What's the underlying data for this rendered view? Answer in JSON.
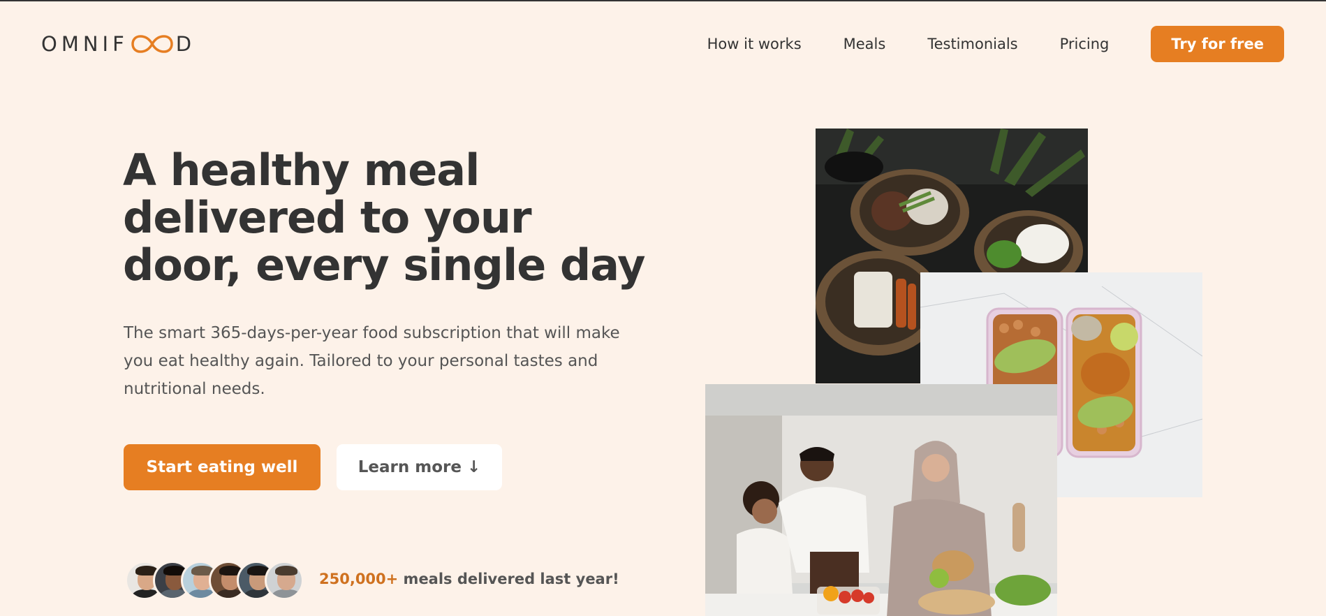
{
  "header": {
    "logo_text_left": "OMNIF",
    "logo_text_right": "D",
    "nav": [
      {
        "label": "How it works"
      },
      {
        "label": "Meals"
      },
      {
        "label": "Testimonials"
      },
      {
        "label": "Pricing"
      }
    ],
    "cta_label": "Try for free"
  },
  "hero": {
    "headline": "A healthy meal delivered to your door, every single day",
    "description": "The smart 365-days-per-year food subscription that will make you eat healthy again. Tailored to your personal tastes and nutritional needs.",
    "primary_button": "Start eating well",
    "secondary_button": "Learn more ↓",
    "delivered_count": "250,000+",
    "delivered_text": " meals delivered last year!"
  },
  "colors": {
    "background": "#fdf2e9",
    "accent": "#e67e22",
    "text_dark": "#333333"
  },
  "icons": [
    "infinity-logo-icon"
  ]
}
